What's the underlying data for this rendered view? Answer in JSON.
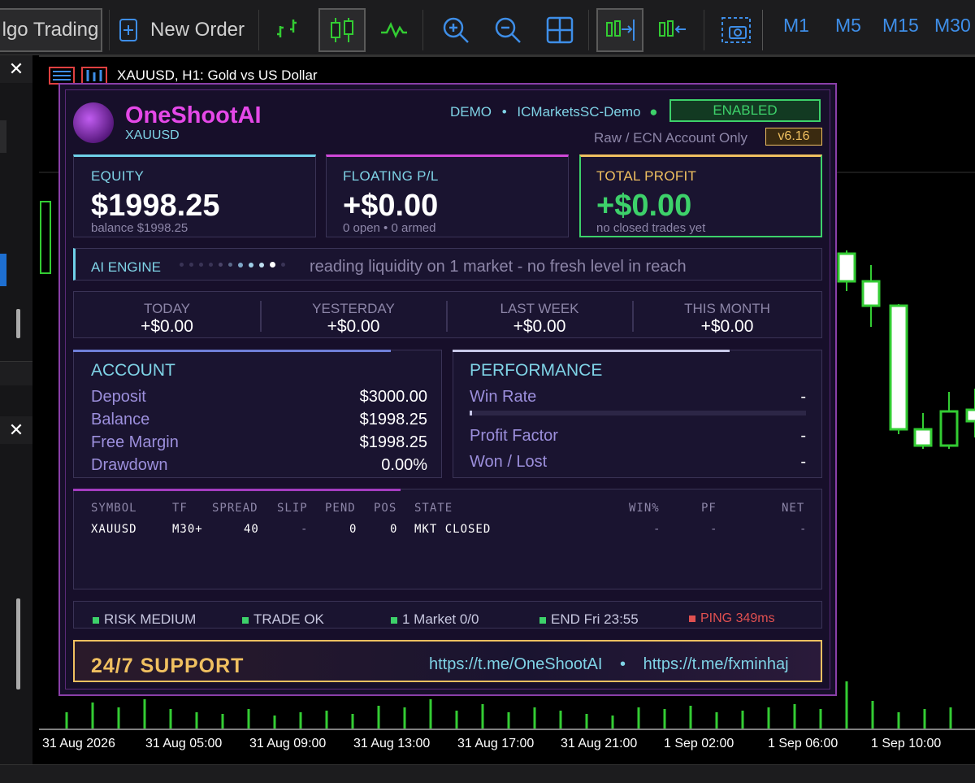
{
  "toolbar": {
    "algo_label": "lgo Trading",
    "new_order_label": "New Order",
    "timeframes": [
      "M1",
      "M5",
      "M15",
      "M30"
    ]
  },
  "chart": {
    "title": "XAUUSD, H1:  Gold vs US Dollar",
    "time_labels": [
      "31 Aug 2026",
      "31 Aug 05:00",
      "31 Aug 09:00",
      "31 Aug 13:00",
      "31 Aug 17:00",
      "31 Aug 21:00",
      "1 Sep 02:00",
      "1 Sep 06:00",
      "1 Sep 10:00"
    ]
  },
  "dash": {
    "brand": "OneShootAI",
    "symbol": "XAUUSD",
    "mode": "DEMO",
    "broker": "ICMarketsSC-Demo",
    "status": "ENABLED",
    "account_note": "Raw / ECN Account Only",
    "version": "v6.16",
    "equity": {
      "label": "EQUITY",
      "value": "$1998.25",
      "sub": "balance  $1998.25"
    },
    "floating": {
      "label": "FLOATING P/L",
      "value": "+$0.00",
      "sub": "0 open  •  0 armed"
    },
    "total": {
      "label": "TOTAL PROFIT",
      "value": "+$0.00",
      "sub": "no closed trades yet"
    },
    "engine": {
      "label": "AI ENGINE",
      "message": "reading liquidity on 1 market - no fresh level in reach"
    },
    "periods": [
      {
        "label": "TODAY",
        "value": "+$0.00"
      },
      {
        "label": "YESTERDAY",
        "value": "+$0.00"
      },
      {
        "label": "LAST WEEK",
        "value": "+$0.00"
      },
      {
        "label": "THIS MONTH",
        "value": "+$0.00"
      }
    ],
    "account": {
      "title": "ACCOUNT",
      "rows": [
        {
          "k": "Deposit",
          "v": "$3000.00"
        },
        {
          "k": "Balance",
          "v": "$1998.25"
        },
        {
          "k": "Free Margin",
          "v": "$1998.25"
        },
        {
          "k": "Drawdown",
          "v": "0.00%"
        }
      ]
    },
    "performance": {
      "title": "PERFORMANCE",
      "win_rate_label": "Win Rate",
      "win_rate": "-",
      "profit_factor_label": "Profit Factor",
      "profit_factor": "-",
      "won_lost_label": "Won / Lost",
      "won_lost": "-"
    },
    "table": {
      "headers": [
        "SYMBOL",
        "TF",
        "SPREAD",
        "SLIP",
        "PEND",
        "POS",
        "STATE",
        "WIN%",
        "PF",
        "NET"
      ],
      "row": [
        "XAUUSD",
        "M30+",
        "40",
        "-",
        "0",
        "0",
        "MKT CLOSED",
        "-",
        "-",
        "-"
      ]
    },
    "status_bar": {
      "risk": "RISK MEDIUM",
      "trade": "TRADE OK",
      "market": "1 Market  0/0",
      "end": "END Fri 23:55",
      "ping": "PING 349ms"
    },
    "support": {
      "label": "24/7 SUPPORT",
      "link1": "https://t.me/OneShootAI",
      "sep": "•",
      "link2": "https://t.me/fxminhaj"
    }
  },
  "colors": {
    "bull": "#33cc33",
    "accent_pink": "#e548e8",
    "accent_cyan": "#7fd3e6",
    "gold": "#f0c060",
    "profit_green": "#3dd16a"
  }
}
